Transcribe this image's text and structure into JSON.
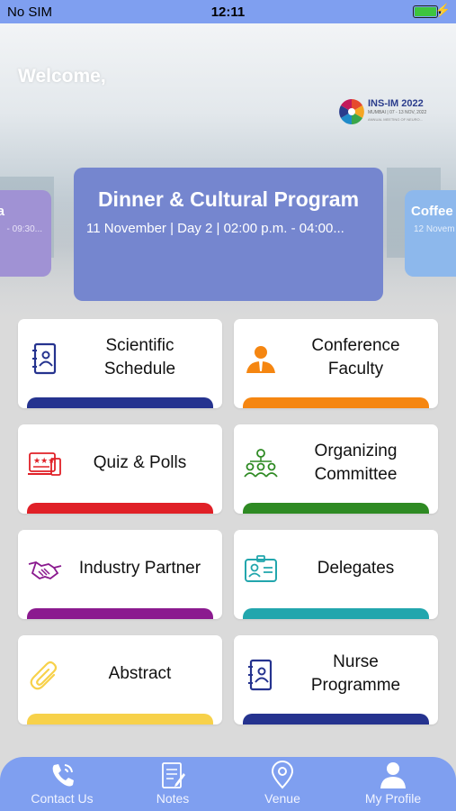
{
  "status_bar": {
    "carrier": "No SIM",
    "time": "12:11"
  },
  "header": {
    "welcome": "Welcome,"
  },
  "logo": {
    "title": "INS-IM 2022",
    "subtitle": "MUMBAI | 07 - 13 NOV, 2022",
    "tagline": "ANNUAL MEETING OF NEURO..."
  },
  "events": {
    "current": {
      "title": "Dinner & Cultural Program",
      "subtitle": "11 November | Day 2 | 02:00 p.m. - 04:00..."
    },
    "previous": {
      "title": "a",
      "subtitle": "- 09:30..."
    },
    "next": {
      "title": "Coffee",
      "subtitle": "12 Novem"
    }
  },
  "menu": [
    {
      "label": "Scientific\nSchedule",
      "icon": "contact-book-icon",
      "color": "#25338f"
    },
    {
      "label": "Conference\nFaculty",
      "icon": "faculty-person-icon",
      "color": "#f58611"
    },
    {
      "label": "Quiz & Polls",
      "icon": "quiz-polls-icon",
      "color": "#e02027"
    },
    {
      "label": "Organizing\nCommittee",
      "icon": "committee-group-icon",
      "color": "#2e8a23"
    },
    {
      "label": "Industry Partner",
      "icon": "handshake-icon",
      "color": "#8b1a8f"
    },
    {
      "label": "Delegates",
      "icon": "id-badge-icon",
      "color": "#22a6ad"
    },
    {
      "label": "Abstract",
      "icon": "paperclip-icon",
      "color": "#f7d14a"
    },
    {
      "label": "Nurse\nProgramme",
      "icon": "contact-book-icon",
      "color": "#25338f"
    }
  ],
  "tabbar": [
    {
      "label": "Contact Us",
      "icon": "phone-icon"
    },
    {
      "label": "Notes",
      "icon": "notes-icon"
    },
    {
      "label": "Venue",
      "icon": "location-pin-icon"
    },
    {
      "label": "My Profile",
      "icon": "profile-icon"
    }
  ],
  "colors": {
    "primary": "#7f9ff0",
    "event_card": "#7586cf"
  }
}
